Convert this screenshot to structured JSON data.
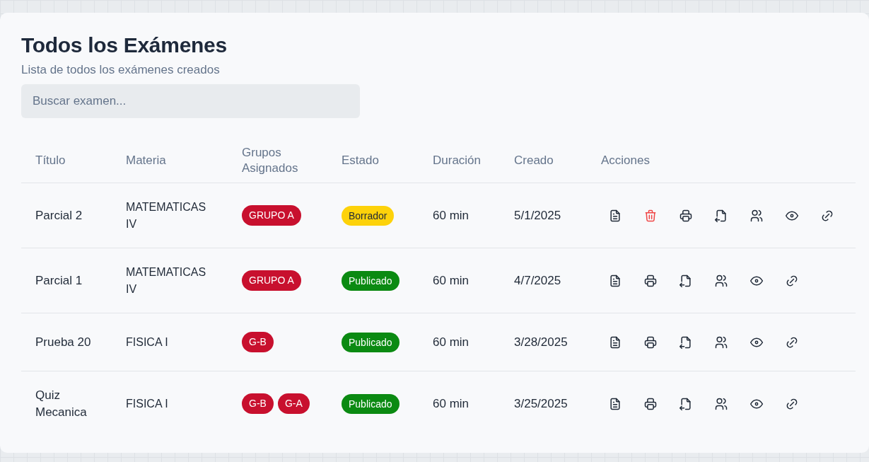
{
  "header": {
    "title": "Todos los Exámenes",
    "subtitle": "Lista de todos los exámenes creados"
  },
  "search": {
    "placeholder": "Buscar examen..."
  },
  "table": {
    "columns": [
      "Título",
      "Materia",
      "Grupos Asignados",
      "Estado",
      "Duración",
      "Creado",
      "Acciones"
    ],
    "rows": [
      {
        "title": "Parcial 2",
        "subject": "MATEMATICAS IV",
        "groups": [
          "GRUPO A"
        ],
        "status": {
          "label": "Borrador",
          "kind": "draft"
        },
        "duration": "60 min",
        "created": "5/1/2025",
        "actions": [
          {
            "kind": "document"
          },
          {
            "kind": "delete"
          },
          {
            "kind": "print"
          },
          {
            "kind": "import"
          },
          {
            "kind": "users"
          },
          {
            "kind": "view"
          },
          {
            "kind": "link"
          }
        ]
      },
      {
        "title": "Parcial 1",
        "subject": "MATEMATICAS IV",
        "groups": [
          "GRUPO A"
        ],
        "status": {
          "label": "Publicado",
          "kind": "published"
        },
        "duration": "60 min",
        "created": "4/7/2025",
        "actions": [
          {
            "kind": "document"
          },
          {
            "kind": "print"
          },
          {
            "kind": "import"
          },
          {
            "kind": "users"
          },
          {
            "kind": "view"
          },
          {
            "kind": "link"
          }
        ]
      },
      {
        "title": "Prueba 20",
        "subject": "FISICA I",
        "groups": [
          "G-B"
        ],
        "status": {
          "label": "Publicado",
          "kind": "published"
        },
        "duration": "60 min",
        "created": "3/28/2025",
        "actions": [
          {
            "kind": "document"
          },
          {
            "kind": "print"
          },
          {
            "kind": "import"
          },
          {
            "kind": "users"
          },
          {
            "kind": "view"
          },
          {
            "kind": "link"
          }
        ]
      },
      {
        "title": "Quiz Mecanica",
        "subject": "FISICA I",
        "groups": [
          "G-B",
          "G-A"
        ],
        "status": {
          "label": "Publicado",
          "kind": "published"
        },
        "duration": "60 min",
        "created": "3/25/2025",
        "actions": [
          {
            "kind": "document"
          },
          {
            "kind": "print"
          },
          {
            "kind": "import"
          },
          {
            "kind": "users"
          },
          {
            "kind": "view"
          },
          {
            "kind": "link"
          }
        ]
      }
    ]
  }
}
